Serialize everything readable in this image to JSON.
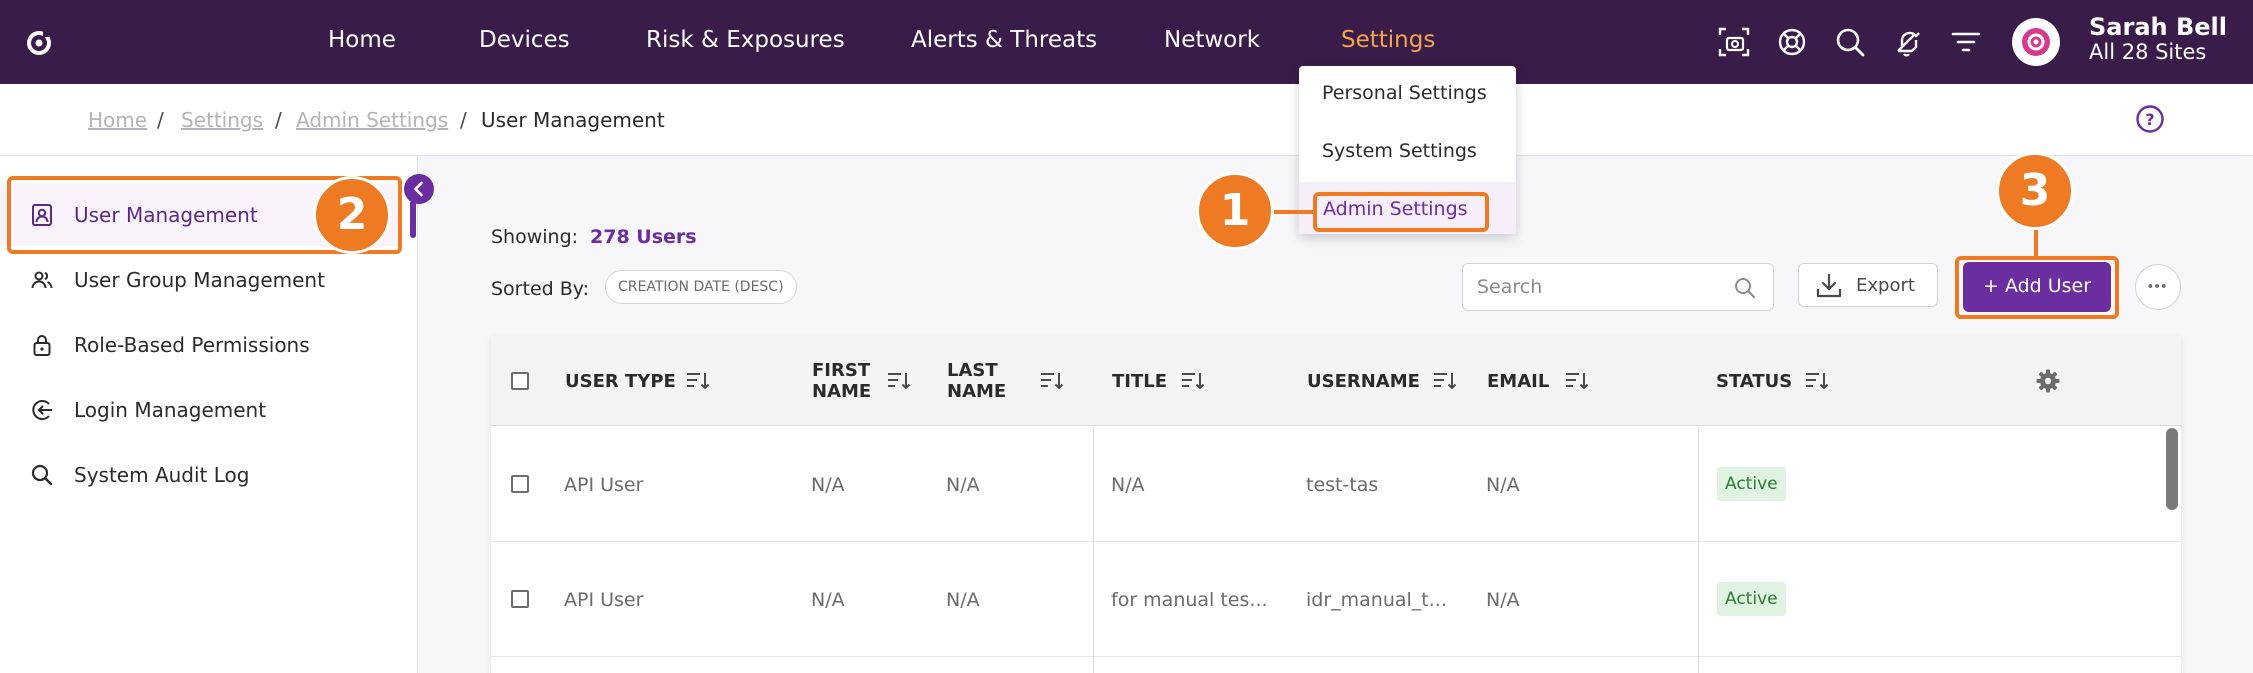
{
  "nav": {
    "items": [
      "Home",
      "Devices",
      "Risk & Exposures",
      "Alerts & Threats",
      "Network",
      "Settings"
    ],
    "active": "Settings"
  },
  "user": {
    "name": "Sarah Bell",
    "sites": "All 28 Sites"
  },
  "breadcrumb": [
    "Home",
    "Settings",
    "Admin Settings",
    "User Management"
  ],
  "settings_menu": [
    "Personal Settings",
    "System Settings",
    "Admin Settings"
  ],
  "sidebar": {
    "items": [
      {
        "label": "User Management",
        "icon": "user-badge-icon"
      },
      {
        "label": "User Group Management",
        "icon": "users-icon"
      },
      {
        "label": "Role-Based Permissions",
        "icon": "lock-icon"
      },
      {
        "label": "Login Management",
        "icon": "login-icon"
      },
      {
        "label": "System Audit Log",
        "icon": "search-icon"
      }
    ]
  },
  "toolbar": {
    "showing_label": "Showing:",
    "showing_value": "278 Users",
    "sorted_label": "Sorted By:",
    "sort_chip": "CREATION DATE (DESC)",
    "search_placeholder": "Search",
    "export_label": "Export",
    "add_user_label": "+ Add User"
  },
  "table": {
    "columns": [
      {
        "line1": "USER TYPE",
        "line2": ""
      },
      {
        "line1": "FIRST",
        "line2": "NAME"
      },
      {
        "line1": "LAST",
        "line2": "NAME"
      },
      {
        "line1": "TITLE",
        "line2": ""
      },
      {
        "line1": "USERNAME",
        "line2": ""
      },
      {
        "line1": "EMAIL",
        "line2": ""
      },
      {
        "line1": "STATUS",
        "line2": ""
      }
    ],
    "rows": [
      {
        "user_type": "API User",
        "first_name": "N/A",
        "last_name": "N/A",
        "title": "N/A",
        "username": "test-tas",
        "email": "N/A",
        "status": "Active"
      },
      {
        "user_type": "API User",
        "first_name": "N/A",
        "last_name": "N/A",
        "title": "for manual tes...",
        "username": "idr_manual_t...",
        "email": "N/A",
        "status": "Active"
      }
    ]
  },
  "callouts": [
    "1",
    "2",
    "3"
  ],
  "colors": {
    "nav_bg": "#3a1c4a",
    "nav_active": "#f1a64b",
    "accent": "#6a2ea0",
    "callout": "#ee7b24",
    "status_active_bg": "#dff3e0",
    "status_active_text": "#2f7a3a"
  }
}
